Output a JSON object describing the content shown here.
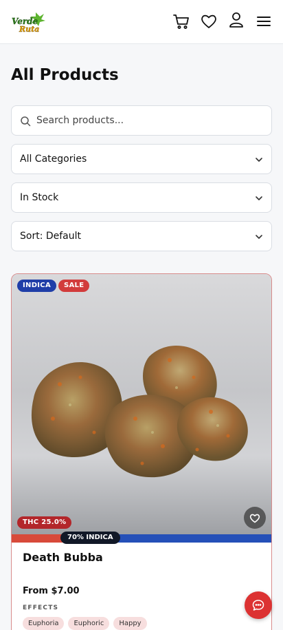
{
  "header": {
    "logo_text": [
      "Verde",
      "Ruta"
    ],
    "icons": [
      "cart-icon",
      "heart-icon",
      "user-icon",
      "menu-icon"
    ]
  },
  "page": {
    "title": "All Products"
  },
  "search": {
    "placeholder": "Search products...",
    "value": ""
  },
  "filters": {
    "category": "All Categories",
    "stock": "In Stock",
    "sort": "Sort: Default"
  },
  "product": {
    "type_badge": "INDICA",
    "sale_badge": "SALE",
    "thc_badge": "THC 25.0%",
    "indica_percent": 70,
    "ratio_label": "70% INDICA",
    "name": "Death Bubba",
    "price": "From $7.00",
    "effects_label": "EFFECTS",
    "effects": [
      "Euphoria",
      "Euphoric",
      "Happy"
    ]
  },
  "colors": {
    "brand_red": "#dc3232",
    "indica_blue": "#1f3ea8",
    "sativa_red": "#d84a3a"
  }
}
